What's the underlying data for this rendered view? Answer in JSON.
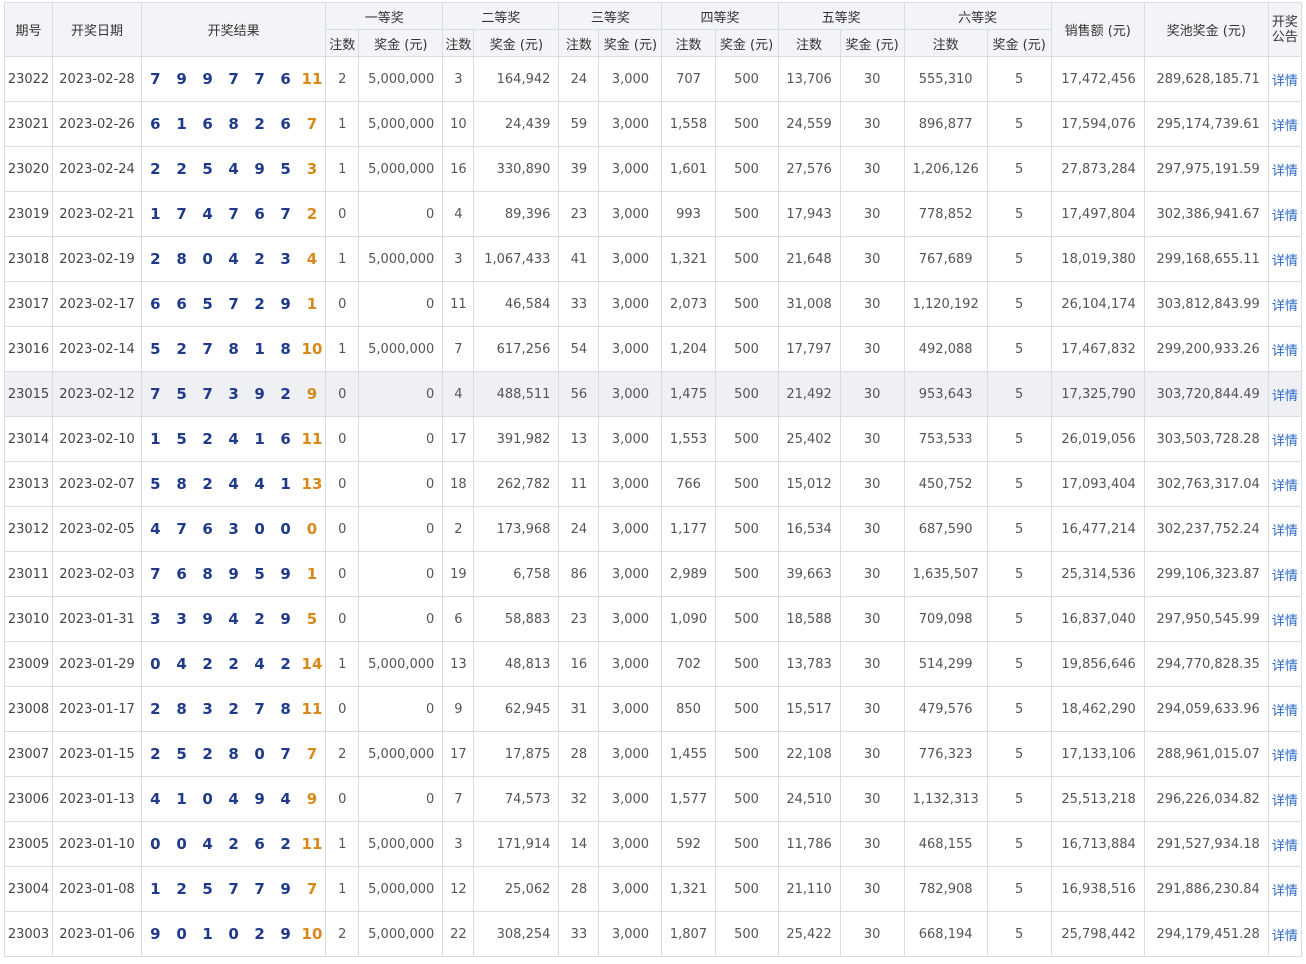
{
  "headers": {
    "issue": "期号",
    "date": "开奖日期",
    "result": "开奖结果",
    "prize1": "一等奖",
    "prize2": "二等奖",
    "prize3": "三等奖",
    "prize4": "四等奖",
    "prize5": "五等奖",
    "prize6": "六等奖",
    "sales": "销售额 (元)",
    "pool": "奖池奖金 (元)",
    "notice": "开奖公告",
    "count": "注数",
    "amount": "奖金 (元)"
  },
  "link_label": "详情",
  "colors": {
    "ball": "#1f3a8a",
    "bonus": "#d8891a",
    "link": "#2a6acb",
    "header_bg": "#f2f4f7",
    "highlight_row": "#eef0f4"
  },
  "highlighted_issue": "23015",
  "rows": [
    {
      "issue": "23022",
      "date": "2023-02-28",
      "balls": [
        "7",
        "9",
        "9",
        "7",
        "7",
        "6"
      ],
      "bonus": "11",
      "p1_count": "2",
      "p1_amount": "5,000,000",
      "p2_count": "3",
      "p2_amount": "164,942",
      "p3_count": "24",
      "p3_amount": "3,000",
      "p4_count": "707",
      "p4_amount": "500",
      "p5_count": "13,706",
      "p5_amount": "30",
      "p6_count": "555,310",
      "p6_amount": "5",
      "sales": "17,472,456",
      "pool": "289,628,185.71"
    },
    {
      "issue": "23021",
      "date": "2023-02-26",
      "balls": [
        "6",
        "1",
        "6",
        "8",
        "2",
        "6"
      ],
      "bonus": "7",
      "p1_count": "1",
      "p1_amount": "5,000,000",
      "p2_count": "10",
      "p2_amount": "24,439",
      "p3_count": "59",
      "p3_amount": "3,000",
      "p4_count": "1,558",
      "p4_amount": "500",
      "p5_count": "24,559",
      "p5_amount": "30",
      "p6_count": "896,877",
      "p6_amount": "5",
      "sales": "17,594,076",
      "pool": "295,174,739.61"
    },
    {
      "issue": "23020",
      "date": "2023-02-24",
      "balls": [
        "2",
        "2",
        "5",
        "4",
        "9",
        "5"
      ],
      "bonus": "3",
      "p1_count": "1",
      "p1_amount": "5,000,000",
      "p2_count": "16",
      "p2_amount": "330,890",
      "p3_count": "39",
      "p3_amount": "3,000",
      "p4_count": "1,601",
      "p4_amount": "500",
      "p5_count": "27,576",
      "p5_amount": "30",
      "p6_count": "1,206,126",
      "p6_amount": "5",
      "sales": "27,873,284",
      "pool": "297,975,191.59"
    },
    {
      "issue": "23019",
      "date": "2023-02-21",
      "balls": [
        "1",
        "7",
        "4",
        "7",
        "6",
        "7"
      ],
      "bonus": "2",
      "p1_count": "0",
      "p1_amount": "0",
      "p2_count": "4",
      "p2_amount": "89,396",
      "p3_count": "23",
      "p3_amount": "3,000",
      "p4_count": "993",
      "p4_amount": "500",
      "p5_count": "17,943",
      "p5_amount": "30",
      "p6_count": "778,852",
      "p6_amount": "5",
      "sales": "17,497,804",
      "pool": "302,386,941.67"
    },
    {
      "issue": "23018",
      "date": "2023-02-19",
      "balls": [
        "2",
        "8",
        "0",
        "4",
        "2",
        "3"
      ],
      "bonus": "4",
      "p1_count": "1",
      "p1_amount": "5,000,000",
      "p2_count": "3",
      "p2_amount": "1,067,433",
      "p3_count": "41",
      "p3_amount": "3,000",
      "p4_count": "1,321",
      "p4_amount": "500",
      "p5_count": "21,648",
      "p5_amount": "30",
      "p6_count": "767,689",
      "p6_amount": "5",
      "sales": "18,019,380",
      "pool": "299,168,655.11"
    },
    {
      "issue": "23017",
      "date": "2023-02-17",
      "balls": [
        "6",
        "6",
        "5",
        "7",
        "2",
        "9"
      ],
      "bonus": "1",
      "p1_count": "0",
      "p1_amount": "0",
      "p2_count": "11",
      "p2_amount": "46,584",
      "p3_count": "33",
      "p3_amount": "3,000",
      "p4_count": "2,073",
      "p4_amount": "500",
      "p5_count": "31,008",
      "p5_amount": "30",
      "p6_count": "1,120,192",
      "p6_amount": "5",
      "sales": "26,104,174",
      "pool": "303,812,843.99"
    },
    {
      "issue": "23016",
      "date": "2023-02-14",
      "balls": [
        "5",
        "2",
        "7",
        "8",
        "1",
        "8"
      ],
      "bonus": "10",
      "p1_count": "1",
      "p1_amount": "5,000,000",
      "p2_count": "7",
      "p2_amount": "617,256",
      "p3_count": "54",
      "p3_amount": "3,000",
      "p4_count": "1,204",
      "p4_amount": "500",
      "p5_count": "17,797",
      "p5_amount": "30",
      "p6_count": "492,088",
      "p6_amount": "5",
      "sales": "17,467,832",
      "pool": "299,200,933.26"
    },
    {
      "issue": "23015",
      "date": "2023-02-12",
      "balls": [
        "7",
        "5",
        "7",
        "3",
        "9",
        "2"
      ],
      "bonus": "9",
      "p1_count": "0",
      "p1_amount": "0",
      "p2_count": "4",
      "p2_amount": "488,511",
      "p3_count": "56",
      "p3_amount": "3,000",
      "p4_count": "1,475",
      "p4_amount": "500",
      "p5_count": "21,492",
      "p5_amount": "30",
      "p6_count": "953,643",
      "p6_amount": "5",
      "sales": "17,325,790",
      "pool": "303,720,844.49"
    },
    {
      "issue": "23014",
      "date": "2023-02-10",
      "balls": [
        "1",
        "5",
        "2",
        "4",
        "1",
        "6"
      ],
      "bonus": "11",
      "p1_count": "0",
      "p1_amount": "0",
      "p2_count": "17",
      "p2_amount": "391,982",
      "p3_count": "13",
      "p3_amount": "3,000",
      "p4_count": "1,553",
      "p4_amount": "500",
      "p5_count": "25,402",
      "p5_amount": "30",
      "p6_count": "753,533",
      "p6_amount": "5",
      "sales": "26,019,056",
      "pool": "303,503,728.28"
    },
    {
      "issue": "23013",
      "date": "2023-02-07",
      "balls": [
        "5",
        "8",
        "2",
        "4",
        "4",
        "1"
      ],
      "bonus": "13",
      "p1_count": "0",
      "p1_amount": "0",
      "p2_count": "18",
      "p2_amount": "262,782",
      "p3_count": "11",
      "p3_amount": "3,000",
      "p4_count": "766",
      "p4_amount": "500",
      "p5_count": "15,012",
      "p5_amount": "30",
      "p6_count": "450,752",
      "p6_amount": "5",
      "sales": "17,093,404",
      "pool": "302,763,317.04"
    },
    {
      "issue": "23012",
      "date": "2023-02-05",
      "balls": [
        "4",
        "7",
        "6",
        "3",
        "0",
        "0"
      ],
      "bonus": "0",
      "p1_count": "0",
      "p1_amount": "0",
      "p2_count": "2",
      "p2_amount": "173,968",
      "p3_count": "24",
      "p3_amount": "3,000",
      "p4_count": "1,177",
      "p4_amount": "500",
      "p5_count": "16,534",
      "p5_amount": "30",
      "p6_count": "687,590",
      "p6_amount": "5",
      "sales": "16,477,214",
      "pool": "302,237,752.24"
    },
    {
      "issue": "23011",
      "date": "2023-02-03",
      "balls": [
        "7",
        "6",
        "8",
        "9",
        "5",
        "9"
      ],
      "bonus": "1",
      "p1_count": "0",
      "p1_amount": "0",
      "p2_count": "19",
      "p2_amount": "6,758",
      "p3_count": "86",
      "p3_amount": "3,000",
      "p4_count": "2,989",
      "p4_amount": "500",
      "p5_count": "39,663",
      "p5_amount": "30",
      "p6_count": "1,635,507",
      "p6_amount": "5",
      "sales": "25,314,536",
      "pool": "299,106,323.87"
    },
    {
      "issue": "23010",
      "date": "2023-01-31",
      "balls": [
        "3",
        "3",
        "9",
        "4",
        "2",
        "9"
      ],
      "bonus": "5",
      "p1_count": "0",
      "p1_amount": "0",
      "p2_count": "6",
      "p2_amount": "58,883",
      "p3_count": "23",
      "p3_amount": "3,000",
      "p4_count": "1,090",
      "p4_amount": "500",
      "p5_count": "18,588",
      "p5_amount": "30",
      "p6_count": "709,098",
      "p6_amount": "5",
      "sales": "16,837,040",
      "pool": "297,950,545.99"
    },
    {
      "issue": "23009",
      "date": "2023-01-29",
      "balls": [
        "0",
        "4",
        "2",
        "2",
        "4",
        "2"
      ],
      "bonus": "14",
      "p1_count": "1",
      "p1_amount": "5,000,000",
      "p2_count": "13",
      "p2_amount": "48,813",
      "p3_count": "16",
      "p3_amount": "3,000",
      "p4_count": "702",
      "p4_amount": "500",
      "p5_count": "13,783",
      "p5_amount": "30",
      "p6_count": "514,299",
      "p6_amount": "5",
      "sales": "19,856,646",
      "pool": "294,770,828.35"
    },
    {
      "issue": "23008",
      "date": "2023-01-17",
      "balls": [
        "2",
        "8",
        "3",
        "2",
        "7",
        "8"
      ],
      "bonus": "11",
      "p1_count": "0",
      "p1_amount": "0",
      "p2_count": "9",
      "p2_amount": "62,945",
      "p3_count": "31",
      "p3_amount": "3,000",
      "p4_count": "850",
      "p4_amount": "500",
      "p5_count": "15,517",
      "p5_amount": "30",
      "p6_count": "479,576",
      "p6_amount": "5",
      "sales": "18,462,290",
      "pool": "294,059,633.96"
    },
    {
      "issue": "23007",
      "date": "2023-01-15",
      "balls": [
        "2",
        "5",
        "2",
        "8",
        "0",
        "7"
      ],
      "bonus": "7",
      "p1_count": "2",
      "p1_amount": "5,000,000",
      "p2_count": "17",
      "p2_amount": "17,875",
      "p3_count": "28",
      "p3_amount": "3,000",
      "p4_count": "1,455",
      "p4_amount": "500",
      "p5_count": "22,108",
      "p5_amount": "30",
      "p6_count": "776,323",
      "p6_amount": "5",
      "sales": "17,133,106",
      "pool": "288,961,015.07"
    },
    {
      "issue": "23006",
      "date": "2023-01-13",
      "balls": [
        "4",
        "1",
        "0",
        "4",
        "9",
        "4"
      ],
      "bonus": "9",
      "p1_count": "0",
      "p1_amount": "0",
      "p2_count": "7",
      "p2_amount": "74,573",
      "p3_count": "32",
      "p3_amount": "3,000",
      "p4_count": "1,577",
      "p4_amount": "500",
      "p5_count": "24,510",
      "p5_amount": "30",
      "p6_count": "1,132,313",
      "p6_amount": "5",
      "sales": "25,513,218",
      "pool": "296,226,034.82"
    },
    {
      "issue": "23005",
      "date": "2023-01-10",
      "balls": [
        "0",
        "0",
        "4",
        "2",
        "6",
        "2"
      ],
      "bonus": "11",
      "p1_count": "1",
      "p1_amount": "5,000,000",
      "p2_count": "3",
      "p2_amount": "171,914",
      "p3_count": "14",
      "p3_amount": "3,000",
      "p4_count": "592",
      "p4_amount": "500",
      "p5_count": "11,786",
      "p5_amount": "30",
      "p6_count": "468,155",
      "p6_amount": "5",
      "sales": "16,713,884",
      "pool": "291,527,934.18"
    },
    {
      "issue": "23004",
      "date": "2023-01-08",
      "balls": [
        "1",
        "2",
        "5",
        "7",
        "7",
        "9"
      ],
      "bonus": "7",
      "p1_count": "1",
      "p1_amount": "5,000,000",
      "p2_count": "12",
      "p2_amount": "25,062",
      "p3_count": "28",
      "p3_amount": "3,000",
      "p4_count": "1,321",
      "p4_amount": "500",
      "p5_count": "21,110",
      "p5_amount": "30",
      "p6_count": "782,908",
      "p6_amount": "5",
      "sales": "16,938,516",
      "pool": "291,886,230.84"
    },
    {
      "issue": "23003",
      "date": "2023-01-06",
      "balls": [
        "9",
        "0",
        "1",
        "0",
        "2",
        "9"
      ],
      "bonus": "10",
      "p1_count": "2",
      "p1_amount": "5,000,000",
      "p2_count": "22",
      "p2_amount": "308,254",
      "p3_count": "33",
      "p3_amount": "3,000",
      "p4_count": "1,807",
      "p4_amount": "500",
      "p5_count": "25,422",
      "p5_amount": "30",
      "p6_count": "668,194",
      "p6_amount": "5",
      "sales": "25,798,442",
      "pool": "294,179,451.28"
    }
  ]
}
